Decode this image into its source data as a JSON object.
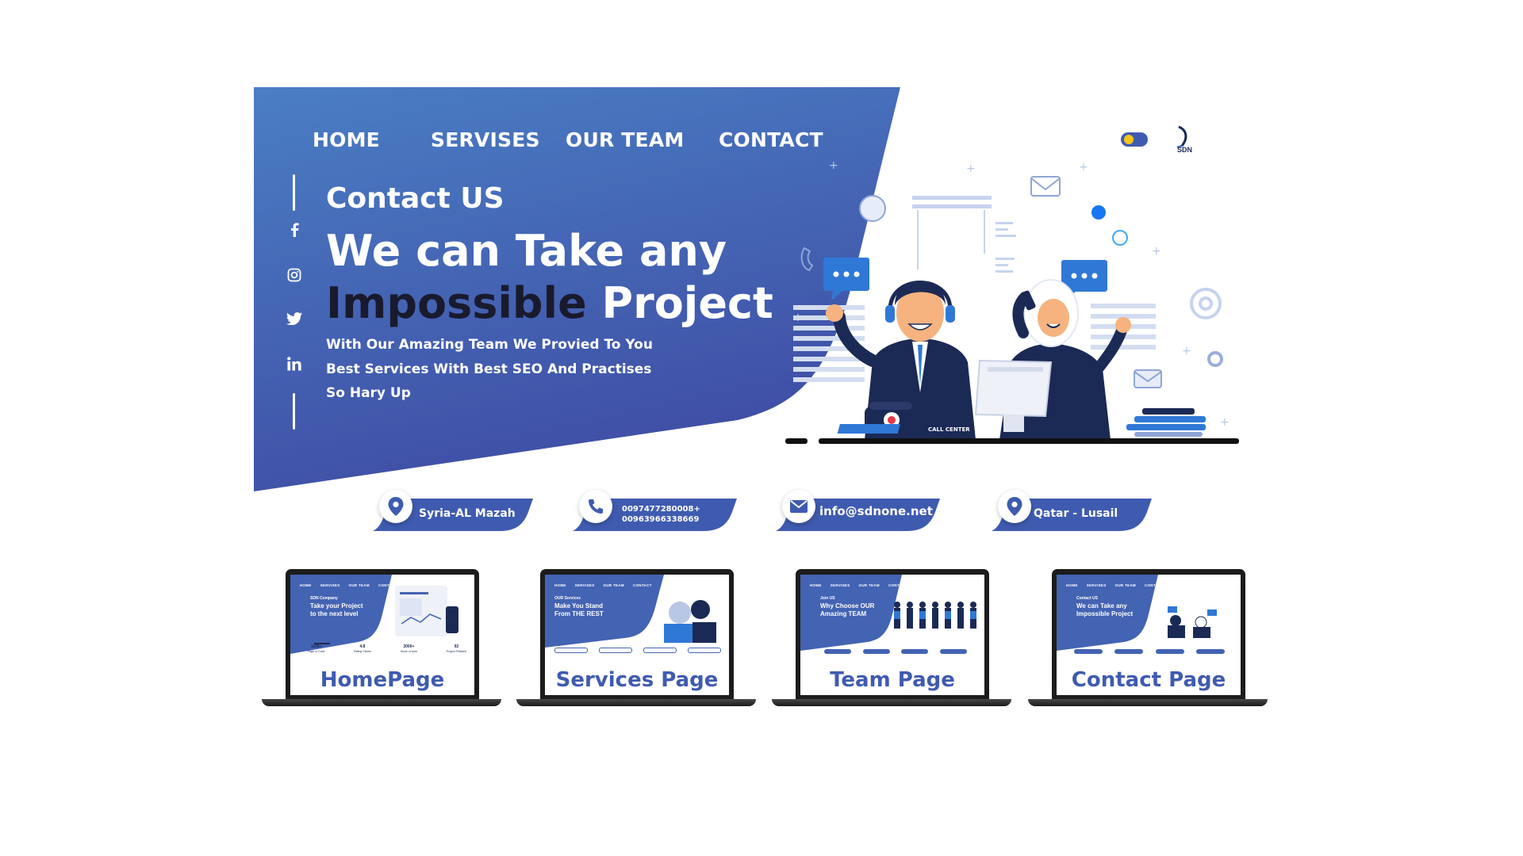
{
  "colors": {
    "hero_start": "#4a7ec4",
    "hero_end": "#3f4ea5",
    "accent": "#3f5bb0",
    "dark_text": "#1a1a2e",
    "white": "#ffffff"
  },
  "nav": {
    "items": [
      {
        "label": "HOME"
      },
      {
        "label": "SERVISES"
      },
      {
        "label": "OUR TEAM"
      },
      {
        "label": "CONTACT"
      }
    ]
  },
  "header": {
    "theme_toggle_icon": "moon-icon",
    "logo_text": "SDN"
  },
  "social": [
    "facebook-icon",
    "instagram-icon",
    "twitter-icon",
    "linkedin-icon"
  ],
  "hero": {
    "subtitle": "Contact US",
    "headline_line1": "We can Take any",
    "headline_dark": "Impossible",
    "headline_rest": " Project",
    "description": "With Our Amazing Team We Provied To You Best Services With Best SEO And Practises So Hary Up",
    "badge": "CALL CENTER"
  },
  "contact_cards": [
    {
      "icon": "location-icon",
      "label": "Syria-AL Mazah"
    },
    {
      "icon": "phone-icon",
      "line1": "0097477280008+",
      "line2": "00963966338669"
    },
    {
      "icon": "mail-icon",
      "label": "info@sdnone.net"
    },
    {
      "icon": "location-icon",
      "label": "Qatar - Lusail"
    }
  ],
  "previews": [
    {
      "label": "HomePage",
      "mini_nav": [
        "HOME",
        "SERVISES",
        "OUR TEAM",
        "CONTACT"
      ],
      "mini_kicker": "SDN Company",
      "mini_title_1": "Take your Project",
      "mini_title_2": "to the next level",
      "stats": [
        {
          "value": "1158+",
          "label": "Page of Code"
        },
        {
          "value": "4.8",
          "label": "Rating Clients"
        },
        {
          "value": "3000+",
          "label": "Hours of work"
        },
        {
          "value": "92",
          "label": "Project Finished"
        }
      ]
    },
    {
      "label": "Services Page",
      "mini_nav": [
        "HOME",
        "SERVISES",
        "OUR TEAM",
        "CONTACT"
      ],
      "mini_kicker": "OUR Services",
      "mini_title_1": "Make You Stand",
      "mini_title_2": "From THE REST"
    },
    {
      "label": "Team Page",
      "mini_nav": [
        "HOME",
        "SERVISES",
        "OUR TEAM",
        "CONTACT"
      ],
      "mini_kicker": "Join US",
      "mini_title_1": "Why Choose OUR",
      "mini_title_2": "Amazing TEAM"
    },
    {
      "label": "Contact Page",
      "mini_nav": [
        "HOME",
        "SERVISES",
        "OUR TEAM",
        "CONTACT"
      ],
      "mini_kicker": "Contact US",
      "mini_title_1": "We can Take any",
      "mini_title_2": "Impossible Project"
    }
  ]
}
